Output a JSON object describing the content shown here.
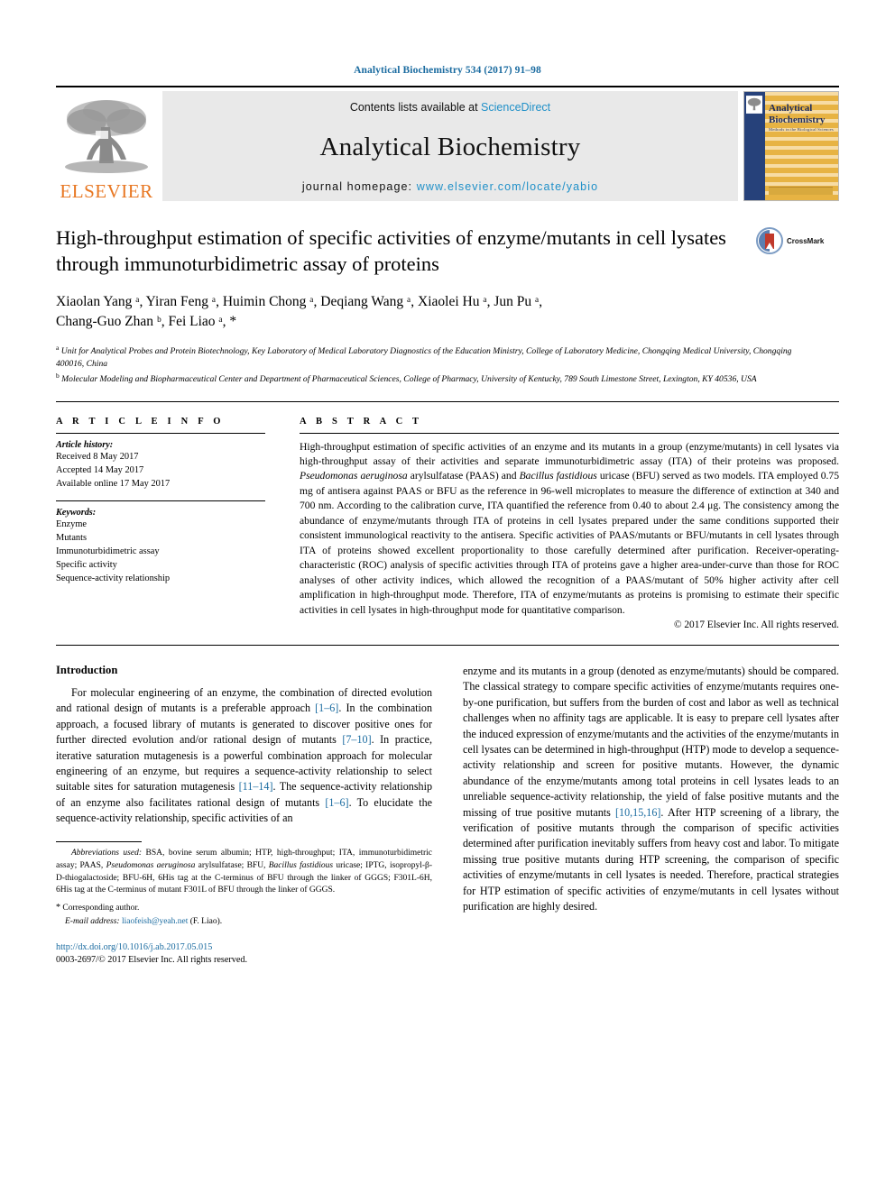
{
  "running_head": "Analytical Biochemistry 534 (2017) 91–98",
  "banner": {
    "publisher_name": "ELSEVIER",
    "contents_prefix": "Contents lists available at ",
    "contents_link": "ScienceDirect",
    "journal_title": "Analytical Biochemistry",
    "homepage_prefix": "journal homepage: ",
    "homepage_url": "www.elsevier.com/locate/yabio",
    "cover": {
      "line1": "Analytical",
      "line2": "Biochemistry",
      "subtitle": "Methods in the Biological Sciences"
    }
  },
  "article": {
    "title": "High-throughput estimation of specific activities of enzyme/mutants in cell lysates through immunoturbidimetric assay of proteins",
    "crossmark_label": "CrossMark",
    "authors_line1": "Xiaolan Yang ᵃ, Yiran Feng ᵃ, Huimin Chong ᵃ, Deqiang Wang ᵃ, Xiaolei Hu ᵃ, Jun Pu ᵃ,",
    "authors_line2": "Chang-Guo Zhan ᵇ, Fei Liao ᵃ, *",
    "authors": [
      {
        "name": "Xiaolan Yang",
        "sup": "a"
      },
      {
        "name": "Yiran Feng",
        "sup": "a"
      },
      {
        "name": "Huimin Chong",
        "sup": "a"
      },
      {
        "name": "Deqiang Wang",
        "sup": "a"
      },
      {
        "name": "Xiaolei Hu",
        "sup": "a"
      },
      {
        "name": "Jun Pu",
        "sup": "a"
      },
      {
        "name": "Chang-Guo Zhan",
        "sup": "b"
      },
      {
        "name": "Fei Liao",
        "sup": "a, *"
      }
    ],
    "affiliations": [
      {
        "sup": "a",
        "text": "Unit for Analytical Probes and Protein Biotechnology, Key Laboratory of Medical Laboratory Diagnostics of the Education Ministry, College of Laboratory Medicine, Chongqing Medical University, Chongqing 400016, China"
      },
      {
        "sup": "b",
        "text": "Molecular Modeling and Biopharmaceutical Center and Department of Pharmaceutical Sciences, College of Pharmacy, University of Kentucky, 789 South Limestone Street, Lexington, KY 40536, USA"
      }
    ]
  },
  "article_info": {
    "heading": "A R T I C L E   I N F O",
    "history_label": "Article history:",
    "history": [
      "Received 8 May 2017",
      "Accepted 14 May 2017",
      "Available online 17 May 2017"
    ],
    "keywords_label": "Keywords:",
    "keywords": [
      "Enzyme",
      "Mutants",
      "Immunoturbidimetric assay",
      "Specific activity",
      "Sequence-activity relationship"
    ]
  },
  "abstract": {
    "heading": "A B S T R A C T",
    "text_parts": [
      {
        "t": "High-throughput estimation of specific activities of an enzyme and its mutants in a group (enzyme/mutants) in cell lysates via high-throughput assay of their activities and separate immunoturbidimetric assay (ITA) of their proteins was proposed. ",
        "i": false
      },
      {
        "t": "Pseudomonas aeruginosa",
        "i": true
      },
      {
        "t": " arylsulfatase (PAAS) and ",
        "i": false
      },
      {
        "t": "Bacillus fastidious",
        "i": true
      },
      {
        "t": " uricase (BFU) served as two models. ITA employed 0.75 mg of antisera against PAAS or BFU as the reference in 96-well microplates to measure the difference of extinction at 340 and 700 nm. According to the calibration curve, ITA quantified the reference from 0.40 to about 2.4 μg. The consistency among the abundance of enzyme/mutants through ITA of proteins in cell lysates prepared under the same conditions supported their consistent immunological reactivity to the antisera. Specific activities of PAAS/mutants or BFU/mutants in cell lysates through ITA of proteins showed excellent proportionality to those carefully determined after purification. Receiver-operating-characteristic (ROC) analysis of specific activities through ITA of proteins gave a higher area-under-curve than those for ROC analyses of other activity indices, which allowed the recognition of a PAAS/mutant of 50% higher activity after cell amplification in high-throughput mode. Therefore, ITA of enzyme/mutants as proteins is promising to estimate their specific activities in cell lysates in high-throughput mode for quantitative comparison.",
        "i": false
      }
    ],
    "copyright": "© 2017 Elsevier Inc. All rights reserved."
  },
  "body": {
    "heading": "Introduction",
    "left_paragraph_parts": [
      {
        "t": "For molecular engineering of an enzyme, the combination of directed evolution and rational design of mutants is a preferable approach ",
        "r": false
      },
      {
        "t": "[1–6]",
        "r": true
      },
      {
        "t": ". In the combination approach, a focused library of mutants is generated to discover positive ones for further directed evolution and/or rational design of mutants ",
        "r": false
      },
      {
        "t": "[7–10]",
        "r": true
      },
      {
        "t": ". In practice, iterative saturation mutagenesis is a powerful combination approach for molecular engineering of an enzyme, but requires a sequence-activity relationship to select suitable sites for saturation mutagenesis ",
        "r": false
      },
      {
        "t": "[11–14]",
        "r": true
      },
      {
        "t": ". The sequence-activity relationship of an enzyme also facilitates rational design of mutants ",
        "r": false
      },
      {
        "t": "[1–6]",
        "r": true
      },
      {
        "t": ". To elucidate the sequence-activity relationship, specific activities of an",
        "r": false
      }
    ],
    "right_paragraph_parts": [
      {
        "t": "enzyme and its mutants in a group (denoted as enzyme/mutants) should be compared. The classical strategy to compare specific activities of enzyme/mutants requires one-by-one purification, but suffers from the burden of cost and labor as well as technical challenges when no affinity tags are applicable. It is easy to prepare cell lysates after the induced expression of enzyme/mutants and the activities of the enzyme/mutants in cell lysates can be determined in high-throughput (HTP) mode to develop a sequence-activity relationship and screen for positive mutants. However, the dynamic abundance of the enzyme/mutants among total proteins in cell lysates leads to an unreliable sequence-activity relationship, the yield of false positive mutants and the missing of true positive mutants ",
        "r": false
      },
      {
        "t": "[10,15,16]",
        "r": true
      },
      {
        "t": ". After HTP screening of a library, the verification of positive mutants through the comparison of specific activities determined after purification inevitably suffers from heavy cost and labor. To mitigate missing true positive mutants during HTP screening, the comparison of specific activities of enzyme/mutants in cell lysates is needed. Therefore, practical strategies for HTP estimation of specific activities of enzyme/mutants in cell lysates without purification are highly desired.",
        "r": false
      }
    ]
  },
  "footnote": {
    "abbrev_label": "Abbreviations used:",
    "abbrev_parts": [
      {
        "t": " BSA, bovine serum albumin; HTP, high-throughput; ITA, immunoturbidimetric assay; PAAS, ",
        "i": false
      },
      {
        "t": "Pseudomonas aeruginosa",
        "i": true
      },
      {
        "t": " arylsulfatase; BFU, ",
        "i": false
      },
      {
        "t": "Bacillus fastidious",
        "i": true
      },
      {
        "t": " uricase; IPTG, isopropyl-β-D-thiogalactoside; BFU-6H, 6His tag at the C-terminus of BFU through the linker of GGGS; F301L-6H, 6His tag at the C-terminus of mutant F301L of BFU through the linker of GGGS.",
        "i": false
      }
    ],
    "corresponding": "Corresponding author.",
    "email_label": "E-mail address:",
    "email": "liaofeish@yeah.net",
    "email_suffix": "(F. Liao)."
  },
  "footer": {
    "doi": "http://dx.doi.org/10.1016/j.ab.2017.05.015",
    "issn_copyright": "0003-2697/© 2017 Elsevier Inc. All rights reserved."
  },
  "colors": {
    "link_blue": "#1a6ba0",
    "sciencedirect_blue": "#2090c8",
    "elsevier_orange": "#E87722",
    "banner_grey": "#e9e9e9"
  }
}
